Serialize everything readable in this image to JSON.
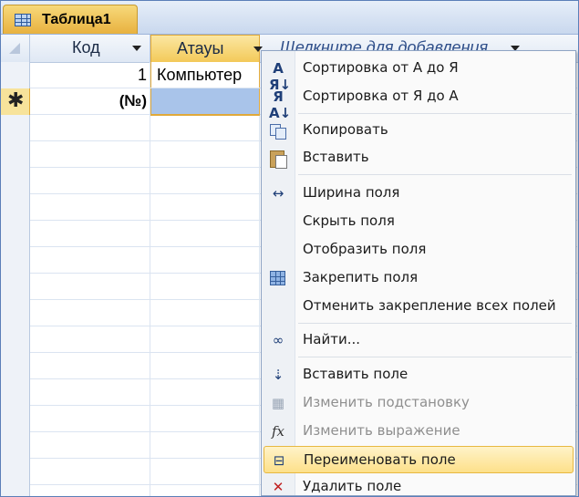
{
  "tab": {
    "label": "Таблица1"
  },
  "columns": {
    "id": "Код",
    "name": "Атауы",
    "add": "Щелкните для добавления"
  },
  "rows": [
    {
      "id": "1",
      "name": "Компьютер"
    }
  ],
  "new_row": {
    "marker": "✱",
    "id": "(№)"
  },
  "context_menu": {
    "items": [
      {
        "label": "Сортировка от А до Я",
        "icon": "sort-asc-icon",
        "disabled": false
      },
      {
        "label": "Сортировка от Я до А",
        "icon": "sort-desc-icon",
        "disabled": false
      },
      {
        "label": "Копировать",
        "icon": "copy-icon",
        "disabled": false
      },
      {
        "label": "Вставить",
        "icon": "paste-icon",
        "disabled": false
      },
      {
        "label": "Ширина поля",
        "icon": "column-width-icon",
        "disabled": false
      },
      {
        "label": "Скрыть поля",
        "icon": "",
        "disabled": false
      },
      {
        "label": "Отобразить поля",
        "icon": "",
        "disabled": false
      },
      {
        "label": "Закрепить поля",
        "icon": "freeze-fields-icon",
        "disabled": false
      },
      {
        "label": "Отменить закрепление всех полей",
        "icon": "",
        "disabled": false
      },
      {
        "label": "Найти...",
        "icon": "find-binoculars-icon",
        "disabled": false
      },
      {
        "label": "Вставить поле",
        "icon": "insert-field-icon",
        "disabled": false
      },
      {
        "label": "Изменить подстановку",
        "icon": "lookup-icon",
        "disabled": true
      },
      {
        "label": "Изменить выражение",
        "icon": "fx-icon",
        "disabled": true
      },
      {
        "label": "Переименовать поле",
        "icon": "rename-field-icon",
        "disabled": false,
        "active": true
      },
      {
        "label": "Удалить поле",
        "icon": "delete-field-icon",
        "disabled": false
      }
    ]
  },
  "colors": {
    "tab_active": "#f0c45a",
    "selected_column": "#f3c959",
    "cell_highlight": "#a9c4ea",
    "menu_hover": "#fde08a"
  }
}
